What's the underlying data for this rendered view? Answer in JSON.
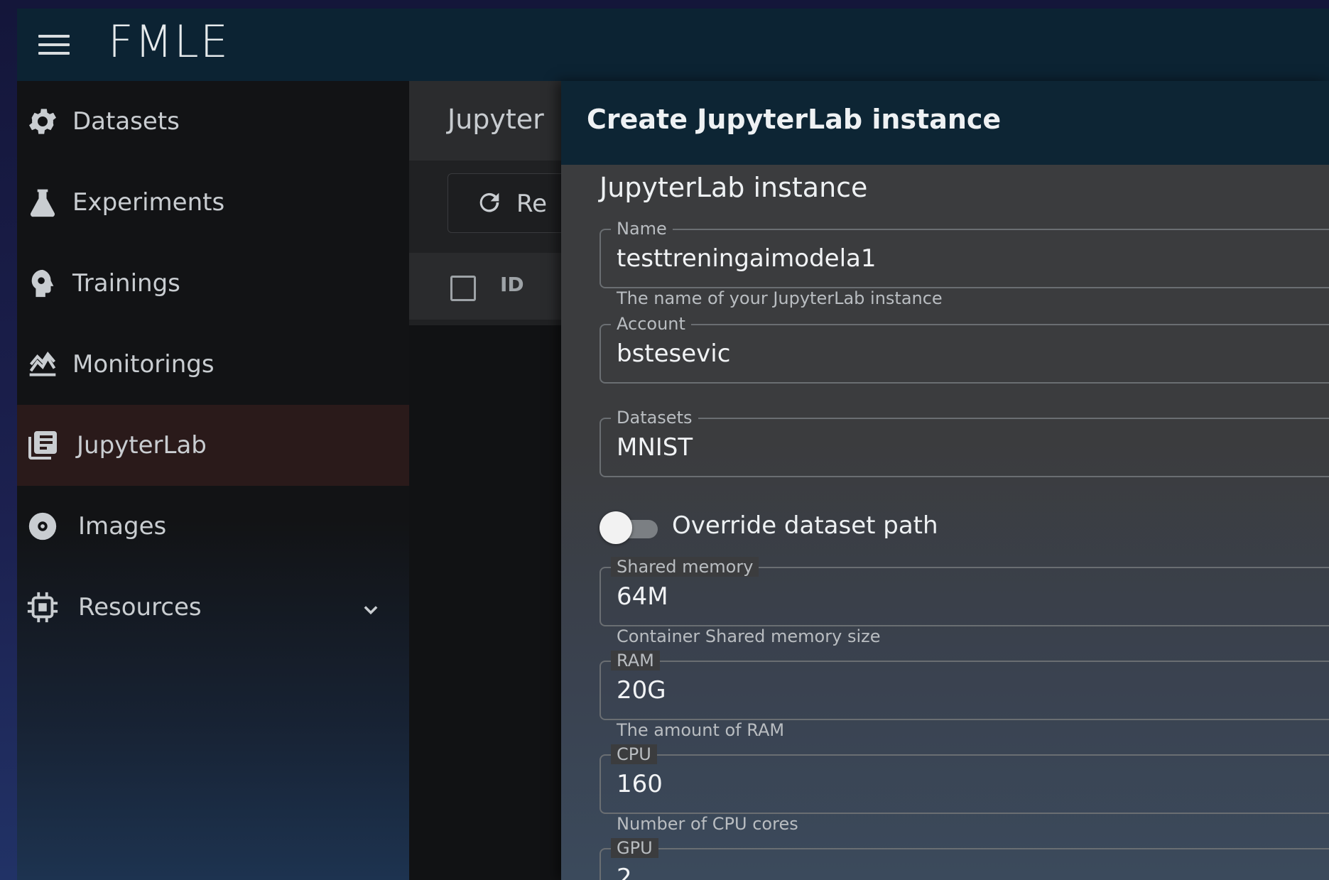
{
  "app": {
    "title": "FMLE"
  },
  "sidebar": {
    "items": [
      {
        "label": "Datasets",
        "icon": "gear-icon"
      },
      {
        "label": "Experiments",
        "icon": "flask-icon"
      },
      {
        "label": "Trainings",
        "icon": "brain-icon"
      },
      {
        "label": "Monitorings",
        "icon": "chart-area-icon"
      },
      {
        "label": "JupyterLab",
        "icon": "notebook-icon",
        "active": true
      },
      {
        "label": "Images",
        "icon": "disc-icon"
      },
      {
        "label": "Resources",
        "icon": "chip-icon",
        "expandable": true
      }
    ]
  },
  "list_panel": {
    "title": "Jupyter",
    "refresh_label": "Re",
    "columns": [
      "ID"
    ]
  },
  "modal": {
    "title": "Create JupyterLab instance",
    "section_title": "JupyterLab instance",
    "fields": {
      "name": {
        "label": "Name",
        "value": "testtreningaimodela1",
        "helper": "The name of your JupyterLab instance"
      },
      "account": {
        "label": "Account",
        "value": "bstesevic"
      },
      "datasets": {
        "label": "Datasets",
        "value": "MNIST"
      },
      "shared_memory": {
        "label": "Shared memory",
        "value": "64M",
        "helper": "Container Shared memory size"
      },
      "ram": {
        "label": "RAM",
        "value": "20G",
        "helper": "The amount of RAM"
      },
      "cpu": {
        "label": "CPU",
        "value": "160",
        "helper": "Number of CPU cores"
      },
      "gpu": {
        "label": "GPU",
        "value": "2"
      }
    },
    "override_toggle": {
      "label": "Override dataset path",
      "checked": false
    }
  },
  "colors": {
    "topbar": "#0c2333",
    "active_nav": "#2a1a1a",
    "modal_bg": "#3b3c3e"
  }
}
